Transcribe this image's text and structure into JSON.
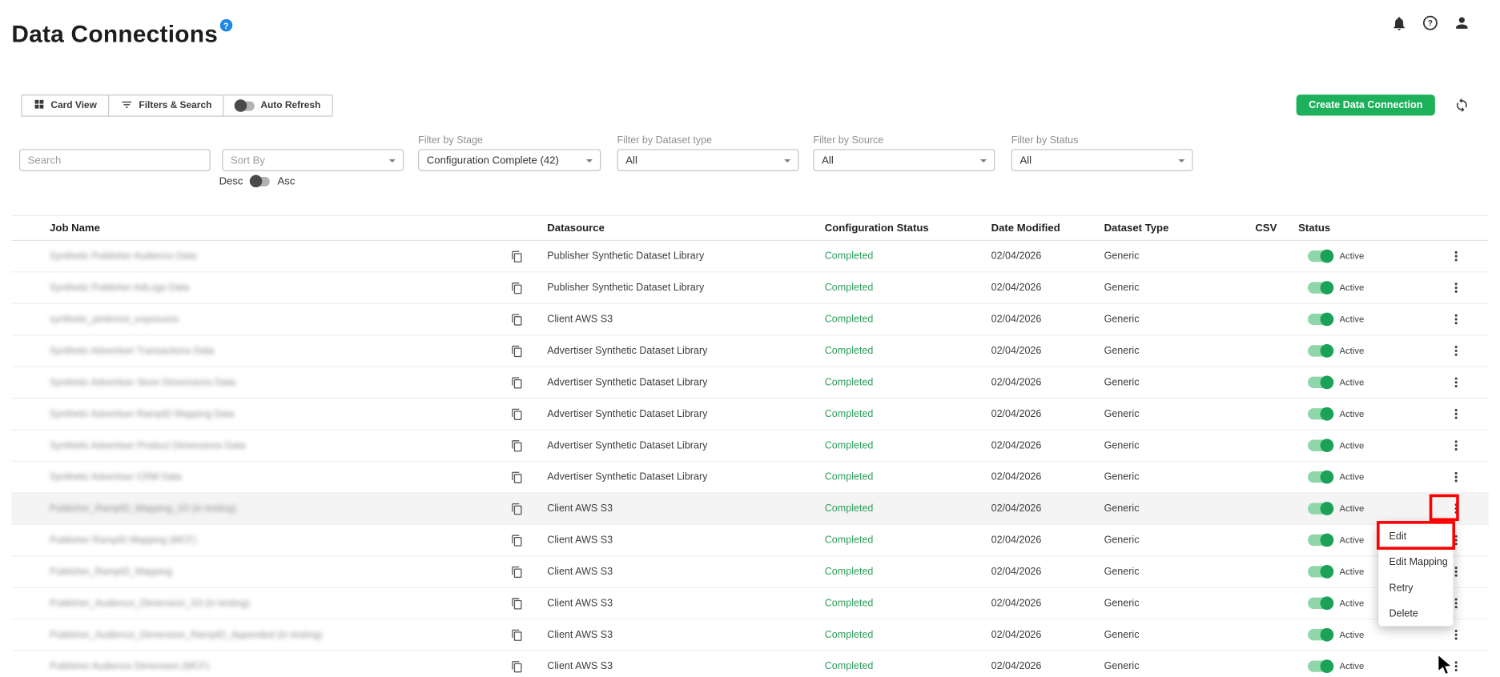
{
  "page": {
    "title": "Data Connections",
    "title_badge": "?"
  },
  "header_icons": [
    "notifications-icon",
    "help-icon",
    "account-icon"
  ],
  "toolbar": {
    "card_view_label": "Card View",
    "filters_search_label": "Filters & Search",
    "auto_refresh_label": "Auto Refresh",
    "create_button_label": "Create Data Connection"
  },
  "filters": {
    "search_placeholder": "Search",
    "sort_by_placeholder": "Sort By",
    "stage": {
      "label": "Filter by Stage",
      "value": "Configuration Complete (42)"
    },
    "dataset_type": {
      "label": "Filter by Dataset type",
      "value": "All"
    },
    "source": {
      "label": "Filter by Source",
      "value": "All"
    },
    "status": {
      "label": "Filter by Status",
      "value": "All"
    },
    "desc_label": "Desc",
    "asc_label": "Asc"
  },
  "table": {
    "columns": [
      "Job Name",
      "Datasource",
      "Configuration Status",
      "Date Modified",
      "Dataset Type",
      "CSV",
      "Status"
    ],
    "rows": [
      {
        "job_name": "Synthetic Publisher Audience Data",
        "datasource": "Publisher Synthetic Dataset Library",
        "configuration_status": "Completed",
        "date_modified": "02/04/2026",
        "dataset_type": "Generic",
        "status_label": "Active",
        "highlighted": false
      },
      {
        "job_name": "Synthetic Publisher AdLogs Data",
        "datasource": "Publisher Synthetic Dataset Library",
        "configuration_status": "Completed",
        "date_modified": "02/04/2026",
        "dataset_type": "Generic",
        "status_label": "Active",
        "highlighted": false
      },
      {
        "job_name": "synthetic_pinterest_exposures",
        "datasource": "Client AWS S3",
        "configuration_status": "Completed",
        "date_modified": "02/04/2026",
        "dataset_type": "Generic",
        "status_label": "Active",
        "highlighted": false
      },
      {
        "job_name": "Synthetic Advertiser Transactions Data",
        "datasource": "Advertiser Synthetic Dataset Library",
        "configuration_status": "Completed",
        "date_modified": "02/04/2026",
        "dataset_type": "Generic",
        "status_label": "Active",
        "highlighted": false
      },
      {
        "job_name": "Synthetic Advertiser Store Dimensions Data",
        "datasource": "Advertiser Synthetic Dataset Library",
        "configuration_status": "Completed",
        "date_modified": "02/04/2026",
        "dataset_type": "Generic",
        "status_label": "Active",
        "highlighted": false
      },
      {
        "job_name": "Synthetic Advertiser RampID Mapping Data",
        "datasource": "Advertiser Synthetic Dataset Library",
        "configuration_status": "Completed",
        "date_modified": "02/04/2026",
        "dataset_type": "Generic",
        "status_label": "Active",
        "highlighted": false
      },
      {
        "job_name": "Synthetic Advertiser Product Dimensions Data",
        "datasource": "Advertiser Synthetic Dataset Library",
        "configuration_status": "Completed",
        "date_modified": "02/04/2026",
        "dataset_type": "Generic",
        "status_label": "Active",
        "highlighted": false
      },
      {
        "job_name": "Synthetic Advertiser CRM Data",
        "datasource": "Advertiser Synthetic Dataset Library",
        "configuration_status": "Completed",
        "date_modified": "02/04/2026",
        "dataset_type": "Generic",
        "status_label": "Active",
        "highlighted": false
      },
      {
        "job_name": "Publisher_RampID_Mapping_S3 (in testing)",
        "datasource": "Client AWS S3",
        "configuration_status": "Completed",
        "date_modified": "02/04/2026",
        "dataset_type": "Generic",
        "status_label": "Active",
        "highlighted": true
      },
      {
        "job_name": "Publisher RampID Mapping (MCF)",
        "datasource": "Client AWS S3",
        "configuration_status": "Completed",
        "date_modified": "02/04/2026",
        "dataset_type": "Generic",
        "status_label": "Active",
        "highlighted": false
      },
      {
        "job_name": "Publisher_RampID_Mapping",
        "datasource": "Client AWS S3",
        "configuration_status": "Completed",
        "date_modified": "02/04/2026",
        "dataset_type": "Generic",
        "status_label": "Active",
        "highlighted": false
      },
      {
        "job_name": "Publisher_Audience_Dimension_S3 (in testing)",
        "datasource": "Client AWS S3",
        "configuration_status": "Completed",
        "date_modified": "02/04/2026",
        "dataset_type": "Generic",
        "status_label": "Active",
        "highlighted": false
      },
      {
        "job_name": "Publisher_Audience_Dimension_RampID_Appended (in testing)",
        "datasource": "Client AWS S3",
        "configuration_status": "Completed",
        "date_modified": "02/04/2026",
        "dataset_type": "Generic",
        "status_label": "Active",
        "highlighted": false
      },
      {
        "job_name": "Publisher Audience Dimension (MCF)",
        "datasource": "Client AWS S3",
        "configuration_status": "Completed",
        "date_modified": "02/04/2026",
        "dataset_type": "Generic",
        "status_label": "Active",
        "highlighted": false
      }
    ]
  },
  "context_menu": {
    "items": [
      "Edit",
      "Edit Mapping",
      "Retry",
      "Delete"
    ]
  },
  "colors": {
    "accent_green": "#1cb15a",
    "completed_green": "#2e9d5c",
    "toggle_green": "#1ba158",
    "badge_blue": "#1e88e5",
    "annotation_red": "#fe0000"
  }
}
